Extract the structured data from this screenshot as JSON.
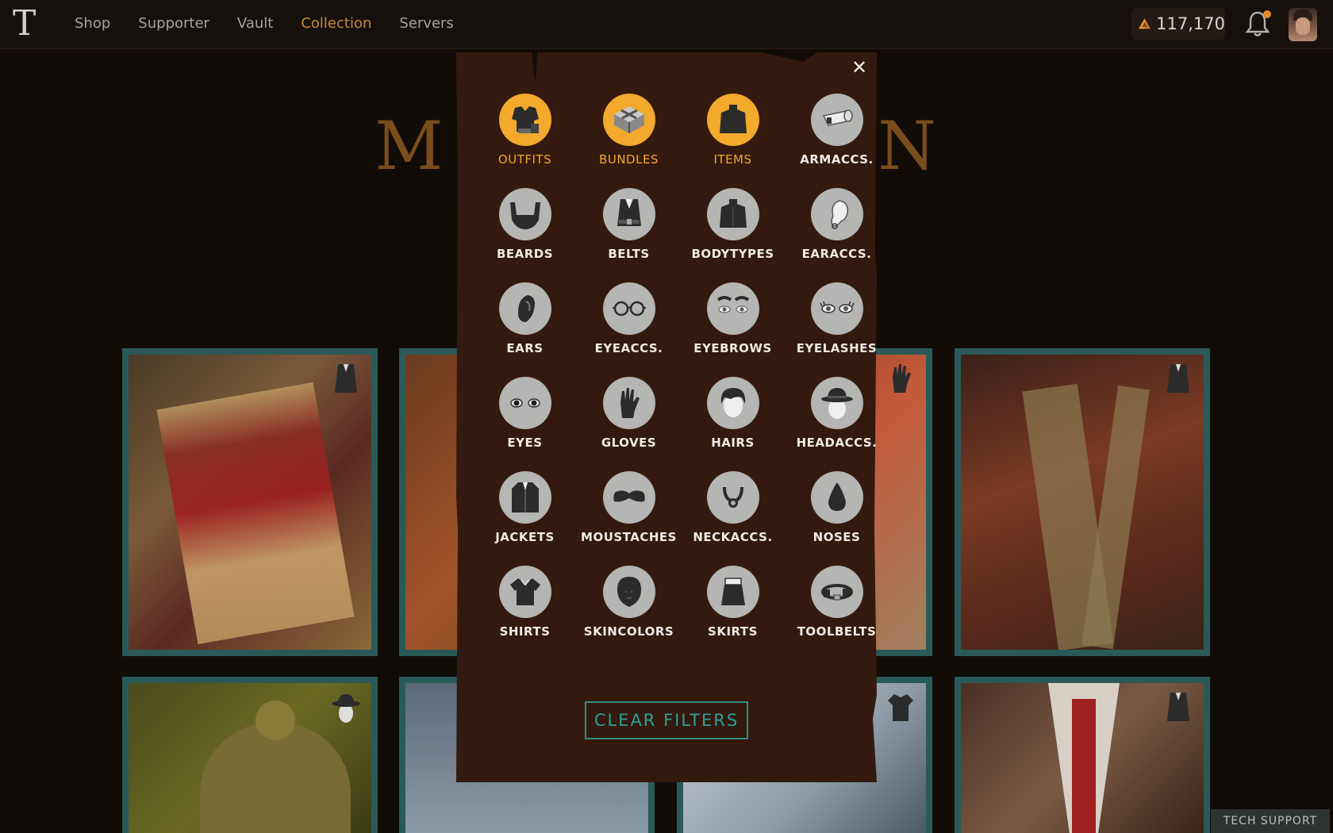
{
  "nav": {
    "logo": "T",
    "items": [
      {
        "label": "Shop",
        "active": false
      },
      {
        "label": "Supporter",
        "active": false
      },
      {
        "label": "Vault",
        "active": false
      },
      {
        "label": "Collection",
        "active": true
      },
      {
        "label": "Servers",
        "active": false
      }
    ],
    "currency": {
      "value": "117,170",
      "icon": "pyramid-coin-icon"
    },
    "notifications": {
      "icon": "bell-icon",
      "has_unread": true
    }
  },
  "page": {
    "title_left": "M",
    "title_right": "N"
  },
  "filter_modal": {
    "categories": [
      {
        "label": "OUTFITS",
        "icon": "outfit-icon",
        "selected": true
      },
      {
        "label": "BUNDLES",
        "icon": "bundle-icon",
        "selected": true
      },
      {
        "label": "ITEMS",
        "icon": "item-icon",
        "selected": true
      },
      {
        "label": "ARMACCS.",
        "icon": "arm-accessory-icon",
        "selected": false
      },
      {
        "label": "BEARDS",
        "icon": "beard-icon",
        "selected": false
      },
      {
        "label": "BELTS",
        "icon": "belt-icon",
        "selected": false
      },
      {
        "label": "BODYTYPES",
        "icon": "bodytype-icon",
        "selected": false
      },
      {
        "label": "EARACCS.",
        "icon": "ear-accessory-icon",
        "selected": false
      },
      {
        "label": "EARS",
        "icon": "ear-icon",
        "selected": false
      },
      {
        "label": "EYEACCS.",
        "icon": "glasses-icon",
        "selected": false
      },
      {
        "label": "EYEBROWS",
        "icon": "eyebrow-icon",
        "selected": false
      },
      {
        "label": "EYELASHES",
        "icon": "eyelash-icon",
        "selected": false
      },
      {
        "label": "EYES",
        "icon": "eye-icon",
        "selected": false
      },
      {
        "label": "GLOVES",
        "icon": "glove-icon",
        "selected": false
      },
      {
        "label": "HAIRS",
        "icon": "hair-icon",
        "selected": false
      },
      {
        "label": "HEADACCS.",
        "icon": "hat-icon",
        "selected": false
      },
      {
        "label": "JACKETS",
        "icon": "jacket-icon",
        "selected": false
      },
      {
        "label": "MOUSTACHES",
        "icon": "moustache-icon",
        "selected": false
      },
      {
        "label": "NECKACCS.",
        "icon": "necklace-icon",
        "selected": false
      },
      {
        "label": "NOSES",
        "icon": "nose-icon",
        "selected": false
      },
      {
        "label": "SHIRTS",
        "icon": "shirt-icon",
        "selected": false
      },
      {
        "label": "SKINCOLORS",
        "icon": "skin-color-icon",
        "selected": false
      },
      {
        "label": "SKIRTS",
        "icon": "skirt-icon",
        "selected": false
      },
      {
        "label": "TOOLBELTS",
        "icon": "toolbelt-icon",
        "selected": false
      }
    ],
    "clear_label": "CLEAR FILTERS",
    "close_icon": "close-icon"
  },
  "footer": {
    "tech_support_label": "TECH SUPPORT"
  },
  "colors": {
    "accent": "#f2a92c",
    "nav_active": "#c8863a",
    "modal_bg": "#33190e",
    "card_border": "#2a5a58",
    "clear_button": "#2e9f95"
  }
}
